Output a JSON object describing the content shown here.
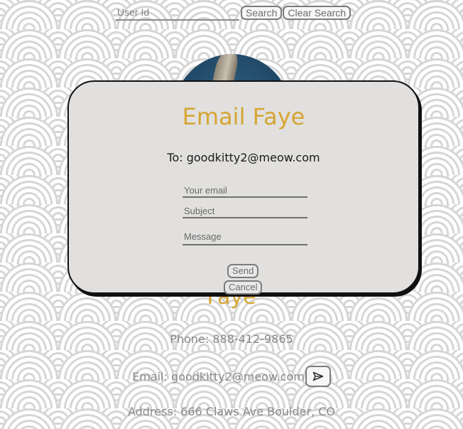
{
  "search": {
    "placeholder": "User Id",
    "search_label": "Search",
    "clear_label": "Clear Search"
  },
  "profile": {
    "name": "Faye",
    "phone": "Phone: 888-412-9865",
    "email": "Email: goodkitty2@meow.com",
    "address": "Address: 666 Claws Ave Boulder, CO"
  },
  "modal": {
    "title": "Email Faye",
    "to": "To: goodkitty2@meow.com",
    "email_placeholder": "Your email",
    "subject_placeholder": "Subject",
    "message_placeholder": "Message",
    "send_label": "Send",
    "cancel_label": "Cancel"
  },
  "icons": {
    "send_mail": "paper-plane-icon"
  },
  "colors": {
    "accent": "#d6a534",
    "modal_bg": "#e1e0de",
    "text_muted": "#8a8a8a"
  }
}
